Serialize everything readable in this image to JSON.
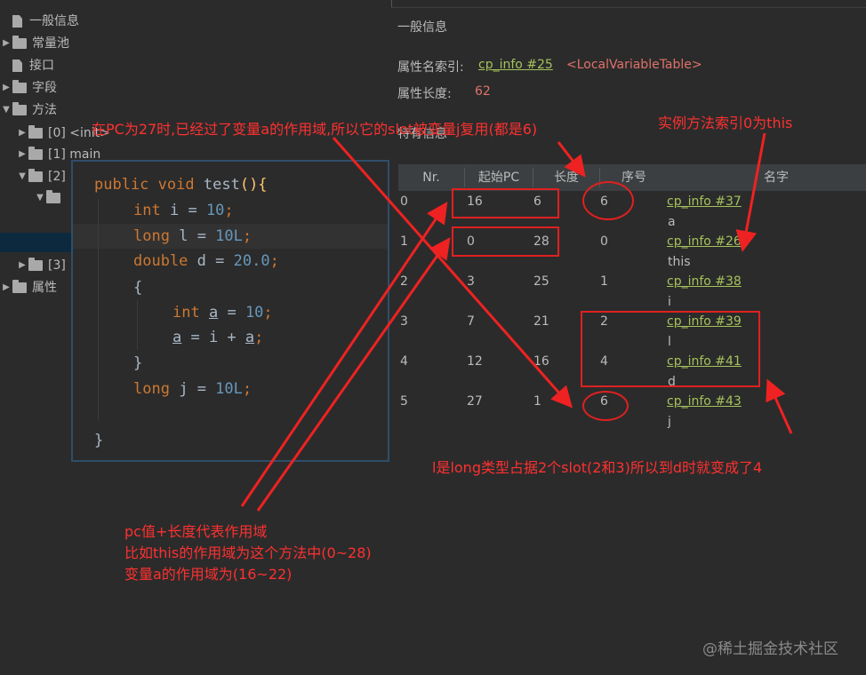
{
  "tree": {
    "items": [
      {
        "label": "一般信息",
        "type": "file"
      },
      {
        "label": "常量池",
        "type": "folder"
      },
      {
        "label": "接口",
        "type": "file"
      },
      {
        "label": "字段",
        "type": "folder"
      },
      {
        "label": "方法",
        "type": "folder"
      },
      {
        "label": "[0] <init>",
        "type": "folder"
      },
      {
        "label": "[1] main",
        "type": "folder"
      },
      {
        "label": "[2]",
        "type": "folder"
      },
      {
        "label": "[3]",
        "type": "folder"
      },
      {
        "label": "属性",
        "type": "folder"
      }
    ]
  },
  "code": {
    "l1_kw1": "public",
    "l1_kw2": "void",
    "l1_fn": "test",
    "l1_rest": "(){",
    "l2_kw": "int",
    "l2_var": "i",
    "l2_op": " = ",
    "l2_num": "10",
    "l2_end": ";",
    "l3_kw": "long",
    "l3_var": "l",
    "l3_op": " = ",
    "l3_num": "10L",
    "l3_end": ";",
    "l4_kw": "double",
    "l4_var": "d",
    "l4_op": " = ",
    "l4_num": "20.0",
    "l4_end": ";",
    "l5": "{",
    "l6_kw": "int",
    "l6_var": "a",
    "l6_op": " = ",
    "l6_num": "10",
    "l6_end": ";",
    "l7_a1": "a",
    "l7_mid": " = i + ",
    "l7_a2": "a",
    "l7_end": ";",
    "l8": "}",
    "l9_kw": "long",
    "l9_var": "j",
    "l9_op": " = ",
    "l9_num": "10L",
    "l9_end": ";",
    "l10": "}"
  },
  "general": {
    "title": "一般信息",
    "name_index_label": "属性名索引:",
    "name_index_link": "cp_info #25",
    "name_index_value": "<LocalVariableTable>",
    "length_label": "属性长度:",
    "length_value": "62"
  },
  "specific": {
    "title": "特有信息",
    "columns": [
      "Nr.",
      "起始PC",
      "长度",
      "序号",
      "名字"
    ],
    "rows": [
      {
        "nr": "0",
        "start": "16",
        "len": "6",
        "idx": "6",
        "link": "cp_info #37",
        "name": "a"
      },
      {
        "nr": "1",
        "start": "0",
        "len": "28",
        "idx": "0",
        "link": "cp_info #26",
        "name": "this"
      },
      {
        "nr": "2",
        "start": "3",
        "len": "25",
        "idx": "1",
        "link": "cp_info #38",
        "name": "i"
      },
      {
        "nr": "3",
        "start": "7",
        "len": "21",
        "idx": "2",
        "link": "cp_info #39",
        "name": "l"
      },
      {
        "nr": "4",
        "start": "12",
        "len": "16",
        "idx": "4",
        "link": "cp_info #41",
        "name": "d"
      },
      {
        "nr": "5",
        "start": "27",
        "len": "1",
        "idx": "6",
        "link": "cp_info #43",
        "name": "j"
      }
    ]
  },
  "annotations": {
    "top": "在PC为27时,已经过了变量a的作用域,所以它的slot被变量j复用(都是6)",
    "this": "实例方法索引0为this",
    "long": "l是long类型占据2个slot(2和3)所以到d时就变成了4",
    "scope1": "pc值+长度代表作用域",
    "scope2": "比如this的作用域为这个方法中(0~28)",
    "scope3": "变量a的作用域为(16~22)"
  },
  "watermark": "@稀土掘金技术社区",
  "colors": {
    "link": "#a5c25c",
    "annotation": "#ff3030",
    "keyword": "#cc7832",
    "number": "#6897bb"
  }
}
